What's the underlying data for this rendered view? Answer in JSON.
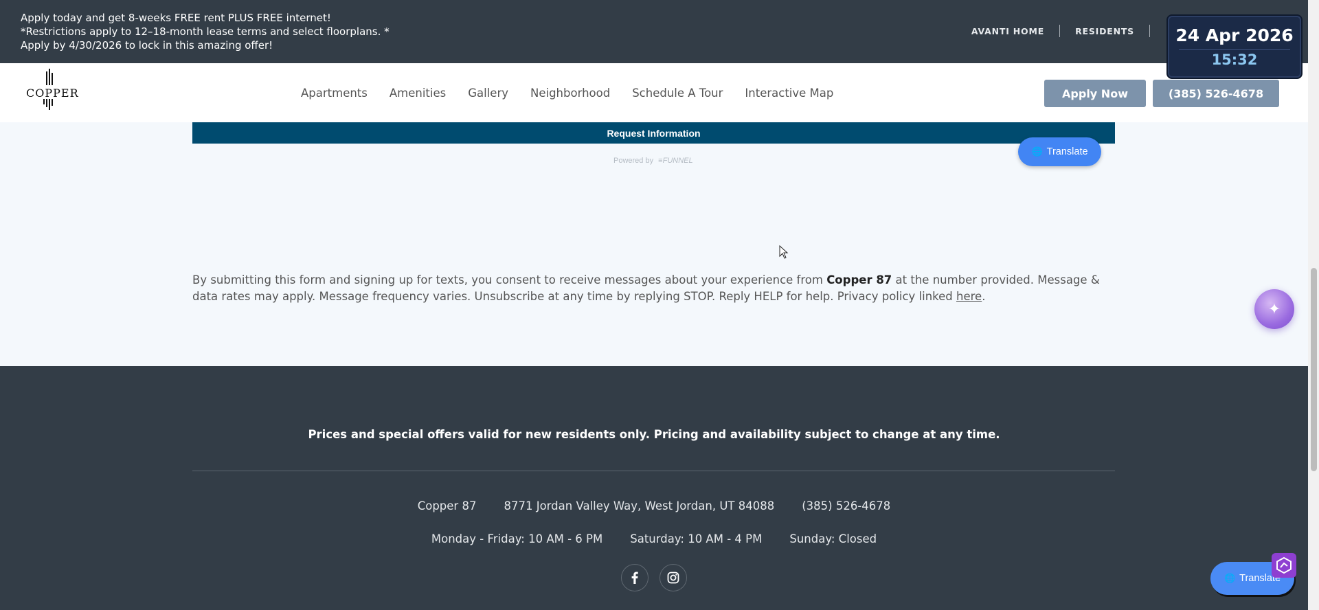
{
  "promo": {
    "line1": "Apply today and get 8-weeks FREE rent PLUS FREE internet!",
    "line2": "*Restrictions apply to 12–18-month lease terms and select floorplans. *",
    "line3": "Apply by 4/30/2026 to lock in this amazing offer!"
  },
  "top_links": {
    "home": "AVANTI HOME",
    "residents": "RESIDENTS"
  },
  "datetime": {
    "date": "24 Apr 2026",
    "time": "15:32"
  },
  "logo": {
    "text": "COPPER"
  },
  "nav": {
    "items": [
      "Apartments",
      "Amenities",
      "Gallery",
      "Neighborhood",
      "Schedule A Tour",
      "Interactive Map"
    ],
    "apply_label": "Apply Now",
    "phone_label": "(385) 526-4678"
  },
  "form": {
    "request_label": "Request Information",
    "powered_by": "Powered by",
    "powered_brand": "FUNNEL"
  },
  "translate": {
    "label": "Translate"
  },
  "consent": {
    "part1": "By submitting this form and signing up for texts, you consent to receive messages about your experience from ",
    "bold_name": "Copper 87",
    "part2": " at the number provided. Message & data rates may apply. Message frequency varies. Unsubscribe at any time by replying STOP. Reply HELP for help. Privacy policy linked ",
    "link": "here",
    "end": "."
  },
  "footer": {
    "disclaimer": "Prices and special offers valid for new residents only. Pricing and availability subject to change at any time.",
    "name": "Copper 87",
    "address": "8771 Jordan Valley Way, West Jordan, UT 84088",
    "phone": "(385) 526-4678",
    "hours_weekday": "Monday - Friday: 10 AM - 6 PM",
    "hours_saturday": "Saturday: 10 AM - 4 PM",
    "hours_sunday": "Sunday: Closed",
    "socials": [
      "facebook-icon",
      "instagram-icon"
    ]
  },
  "colors": {
    "dark_bar": "#333d47",
    "button": "#7d93ab",
    "request_bar": "#004b6f",
    "translate_blue": "#4285f4"
  }
}
